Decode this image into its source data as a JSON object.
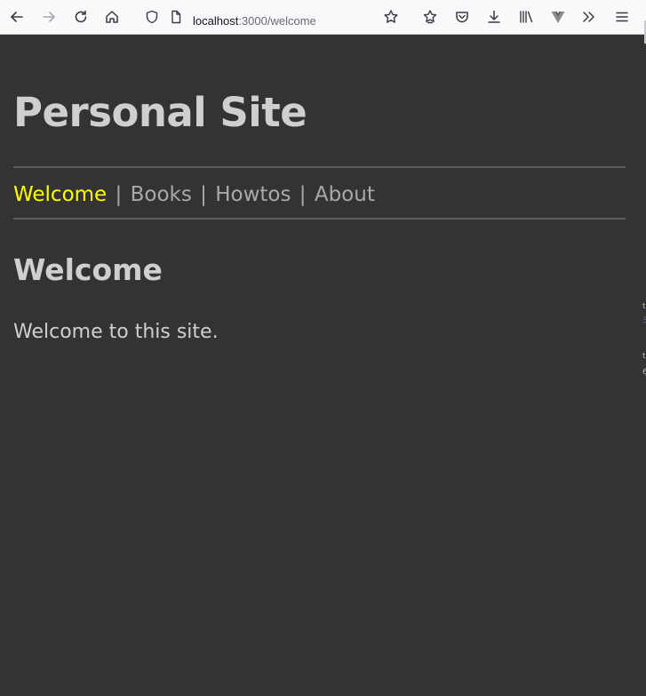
{
  "browser": {
    "url_host": "localhost",
    "url_path": ":3000/welcome",
    "buttons": {
      "back": "back-icon",
      "forward": "forward-icon",
      "reload": "reload-icon",
      "home": "home-icon",
      "bookmark": "star-icon",
      "extensions": "extensions-icon",
      "pocket": "pocket-icon",
      "downloads": "download-icon",
      "library": "library-icon",
      "vue": "vue-devtools-icon",
      "overflow": "overflow-chevron-icon",
      "menu": "hamburger-menu-icon"
    }
  },
  "site": {
    "title": "Personal Site",
    "nav": {
      "items": [
        {
          "label": "Welcome",
          "active": true
        },
        {
          "label": "Books",
          "active": false
        },
        {
          "label": "Howtos",
          "active": false
        },
        {
          "label": "About",
          "active": false
        }
      ],
      "separator": "|"
    },
    "heading": "Welcome",
    "body": "Welcome to this site."
  },
  "colors": {
    "page_background": "#333333",
    "text": "#cfcfcf",
    "nav_link": "#a9a9a9",
    "nav_active": "#ffff00",
    "rule": "#5c5c5c",
    "toolbar_background": "#f9f9fb"
  }
}
